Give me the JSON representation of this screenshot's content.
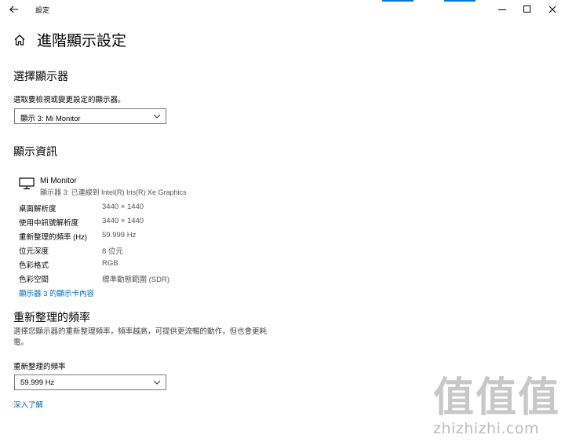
{
  "window": {
    "app_title": "設定",
    "back_icon": "back-arrow-icon",
    "controls": {
      "minimize": "minimize-icon",
      "maximize": "maximize-icon",
      "close": "close-icon"
    },
    "accent_color": "#0078d4"
  },
  "page": {
    "title": "進階顯示設定",
    "home_icon": "home-icon"
  },
  "select_display": {
    "heading": "選擇顯示器",
    "prompt": "選取要檢視或變更設定的顯示器。",
    "selected": "顯示 3: Mi Monitor"
  },
  "display_info": {
    "heading": "顯示資訊",
    "monitor_name": "Mi Monitor",
    "monitor_sub": "顯示器 3: 已連線到 Intel(R) Iris(R) Xe Graphics",
    "rows": [
      {
        "key": "桌面解析度",
        "value": "3440 × 1440"
      },
      {
        "key": "使用中訊號解析度",
        "value": "3440 × 1440"
      },
      {
        "key": "重新整理的頻率 (Hz)",
        "value": "59.999 Hz"
      },
      {
        "key": "位元深度",
        "value": "8 位元"
      },
      {
        "key": "色彩格式",
        "value": "RGB"
      },
      {
        "key": "色彩空間",
        "value": "標準動態範圍 (SDR)"
      }
    ],
    "adapter_link": "顯示器 3 的顯示卡內容"
  },
  "refresh_rate": {
    "heading": "重新整理的頻率",
    "description": "選擇您顯示器的重新整理頻率，頻率越高，可提供更流暢的動作，但也會更耗電。",
    "label": "重新整理的頻率",
    "selected": "59.999 Hz",
    "learn_more": "深入了解"
  },
  "watermark": {
    "glyphs": [
      "值",
      "值",
      "值"
    ],
    "text": "zhizhizhi.com"
  }
}
